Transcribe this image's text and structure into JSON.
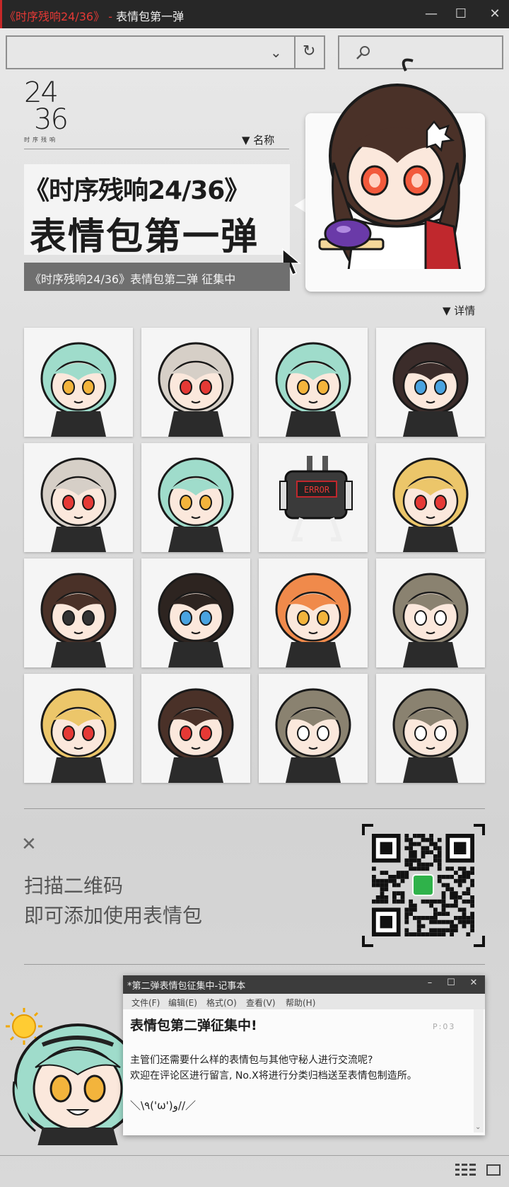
{
  "window": {
    "title_highlight": "《时序残响24/36》",
    "title_separator": " - ",
    "title_rest": "表情包第一弹",
    "minimize": "—",
    "maximize": "☐",
    "close": "✕"
  },
  "toolbar": {
    "dropdown_glyph": "⌄",
    "refresh_glyph": "↻"
  },
  "header": {
    "logo_text": "24/36",
    "logo_top": "24",
    "logo_bottom": "36",
    "logo_sub": "时序残响",
    "name_label": "▼ 名称",
    "title_line1": "《时序残响24/36》",
    "title_line2": "表情包第一弹",
    "subtitle": "《时序残响24/36》表情包第二弹 征集中",
    "detail_label": "▼ 详情"
  },
  "stickers": [
    {
      "name": "green-hair-sun"
    },
    {
      "name": "white-hair-smirk"
    },
    {
      "name": "green-hair-cloud"
    },
    {
      "name": "dark-hair-cloth"
    },
    {
      "name": "white-hair-confused"
    },
    {
      "name": "green-hair-splash"
    },
    {
      "name": "robot-error"
    },
    {
      "name": "blonde-door"
    },
    {
      "name": "brown-hair-shiver"
    },
    {
      "name": "dark-hair-bike"
    },
    {
      "name": "orange-hair-beanbag"
    },
    {
      "name": "gray-hair-angry"
    },
    {
      "name": "blonde-thumbs-up"
    },
    {
      "name": "brown-hair-bowl"
    },
    {
      "name": "gray-hair-ghost"
    },
    {
      "name": "gray-hair-tired"
    }
  ],
  "error_label": "ERROR",
  "qr_section": {
    "close_glyph": "✕",
    "line1": "扫描二维码",
    "line2": "即可添加使用表情包"
  },
  "notepad": {
    "title": "*第二弹表情包征集中-记事本",
    "min": "–",
    "max": "☐",
    "close": "✕",
    "menu": [
      "文件(F)",
      "编辑(E)",
      "格式(O)",
      "查看(V)",
      "帮助(H)"
    ],
    "heading": "表情包第二弹征集中!",
    "body1": "主管们还需要什么样的表情包与其他守秘人进行交流呢?",
    "body2": "欢迎在评论区进行留言, No.X将进行分类归档送至表情包制造所。",
    "kaomoji": "＼\\٩('ω')و//／",
    "page_mark": "P:03",
    "scroll_arrow": "⌄"
  },
  "colors": {
    "accent": "#c62828",
    "titlebar": "#272727",
    "hair_green": "#8fd3c0",
    "eye_red": "#e53935"
  }
}
